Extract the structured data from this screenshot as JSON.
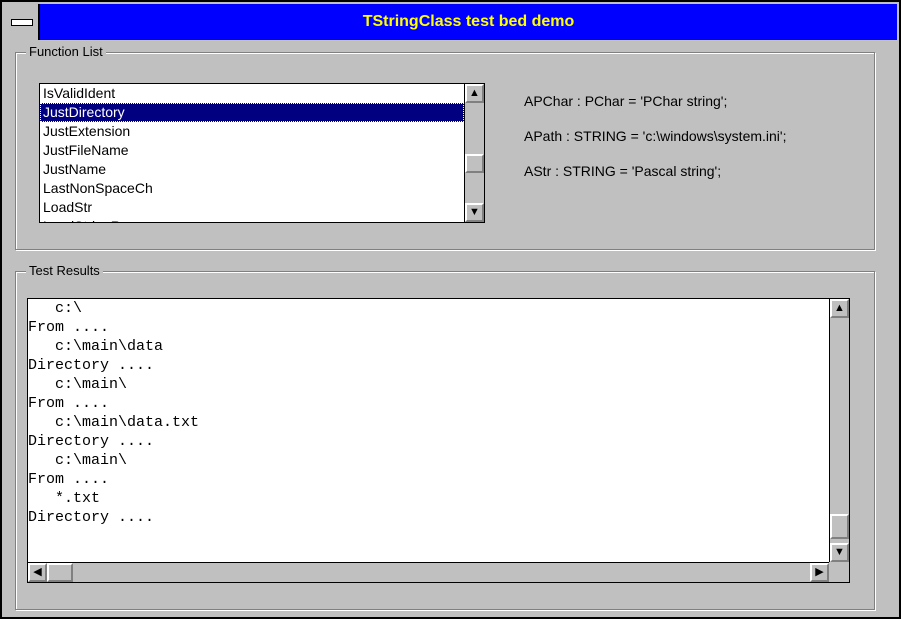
{
  "window": {
    "title": "TStringClass test bed demo"
  },
  "function_list": {
    "group_label": "Function List",
    "items": [
      "IsValidIdent",
      "JustDirectory",
      "JustExtension",
      "JustFileName",
      "JustName",
      "LastNonSpaceCh",
      "LoadStr",
      "LoadStringRes"
    ],
    "selected_index": 1
  },
  "declarations": {
    "apchar": "APChar : PChar = 'PChar string';",
    "apath": "APath : STRING = 'c:\\windows\\system.ini';",
    "astr": "AStr : STRING = 'Pascal string';"
  },
  "test_results": {
    "group_label": "Test Results",
    "lines": [
      "   c:\\",
      "From ....",
      "   c:\\main\\data",
      "Directory ....",
      "   c:\\main\\",
      "From ....",
      "   c:\\main\\data.txt",
      "Directory ....",
      "   c:\\main\\",
      "From ....",
      "   *.txt",
      "Directory ...."
    ]
  },
  "icons": {
    "scroll_up": "▲",
    "scroll_down": "▼",
    "scroll_left": "◀",
    "scroll_right": "▶"
  },
  "colors": {
    "titlebar": "#0000ff",
    "title_text": "#ffff00",
    "selection": "#000080",
    "face": "#c0c0c0"
  }
}
